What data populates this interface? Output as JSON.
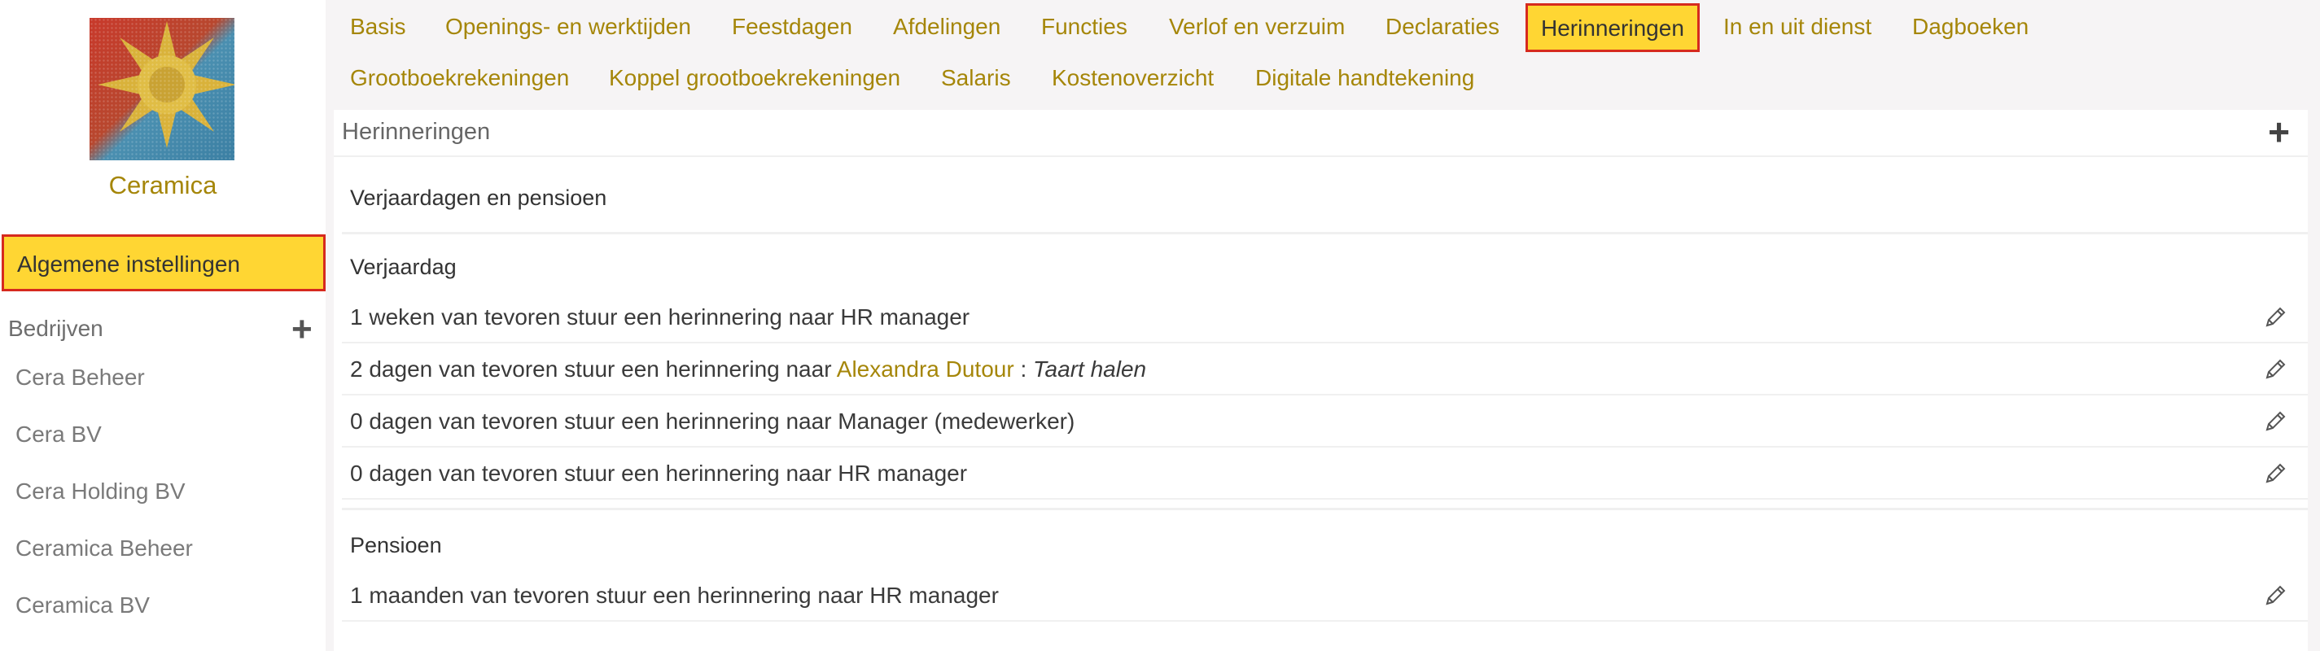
{
  "sidebar": {
    "company_name": "Ceramica",
    "settings_label": "Algemene instellingen",
    "companies_header": "Bedrijven",
    "add_icon": "plus-icon",
    "companies": [
      "Cera Beheer",
      "Cera BV",
      "Cera Holding BV",
      "Ceramica Beheer",
      "Ceramica BV"
    ]
  },
  "tabs": [
    "Basis",
    "Openings- en werktijden",
    "Feestdagen",
    "Afdelingen",
    "Functies",
    "Verlof en verzuim",
    "Declaraties",
    "Herinneringen",
    "In en uit dienst",
    "Dagboeken",
    "Grootboekrekeningen",
    "Koppel grootboekrekeningen",
    "Salaris",
    "Kostenoverzicht",
    "Digitale handtekening"
  ],
  "active_tab": "Herinneringen",
  "panel": {
    "title": "Herinneringen",
    "section_title": "Verjaardagen en pensioen",
    "groups": [
      {
        "title": "Verjaardag",
        "rows": [
          {
            "text": "1 weken van tevoren stuur een herinnering naar HR manager"
          },
          {
            "text": "2 dagen van tevoren stuur een herinnering naar ",
            "person": "Alexandra Dutour",
            "sep": " : ",
            "note": "Taart halen"
          },
          {
            "text": "0 dagen van tevoren stuur een herinnering naar Manager (medewerker)"
          },
          {
            "text": "0 dagen van tevoren stuur een herinnering naar HR manager"
          }
        ]
      },
      {
        "title": "Pensioen",
        "rows": [
          {
            "text": "1 maanden van tevoren stuur een herinnering naar HR manager"
          }
        ]
      }
    ]
  },
  "colors": {
    "accent": "#a58609",
    "active_bg": "#ffd633",
    "active_border": "#d62a1e"
  }
}
